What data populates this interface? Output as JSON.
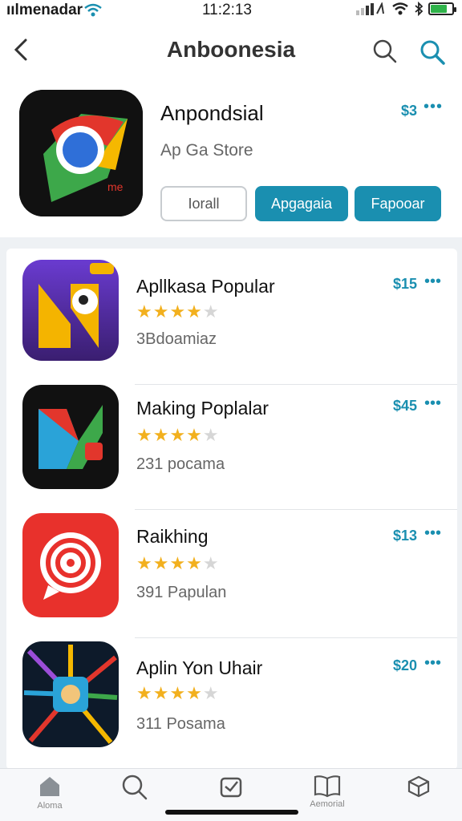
{
  "status_bar": {
    "carrier": "ıılmenadar",
    "time": "11:2:13"
  },
  "navbar": {
    "title": "Anboonesia"
  },
  "featured": {
    "name": "Anpondsial",
    "subtitle": "Ap Ga Store",
    "price": "$3",
    "more": "•••",
    "buttons": {
      "install": "Iorall",
      "primary": "Apgagaia",
      "secondary": "Fapooar"
    }
  },
  "apps": [
    {
      "name": "Apllkasa Popular",
      "rating": 4,
      "meta": "3Bdoamiaz",
      "price": "$15",
      "more": "•••"
    },
    {
      "name": "Making Poplalar",
      "rating": 4,
      "meta": "231 pocama",
      "price": "$45",
      "more": "•••"
    },
    {
      "name": "Raikhing",
      "rating": 4,
      "meta": "391 Papulan",
      "price": "$13",
      "more": "•••"
    },
    {
      "name": "Aplin Yon Uhair",
      "rating": 4,
      "meta": "311 Posama",
      "price": "$20",
      "more": "•••"
    }
  ],
  "tabbar": {
    "tabs": [
      {
        "icon": "home-icon",
        "label": "Aloma"
      },
      {
        "icon": "search-icon",
        "label": ""
      },
      {
        "icon": "mail-icon",
        "label": ""
      },
      {
        "icon": "book-icon",
        "label": "Aemorial"
      },
      {
        "icon": "box-icon",
        "label": ""
      }
    ]
  },
  "colors": {
    "accent": "#1a8fb0",
    "star": "#f2b01e"
  }
}
